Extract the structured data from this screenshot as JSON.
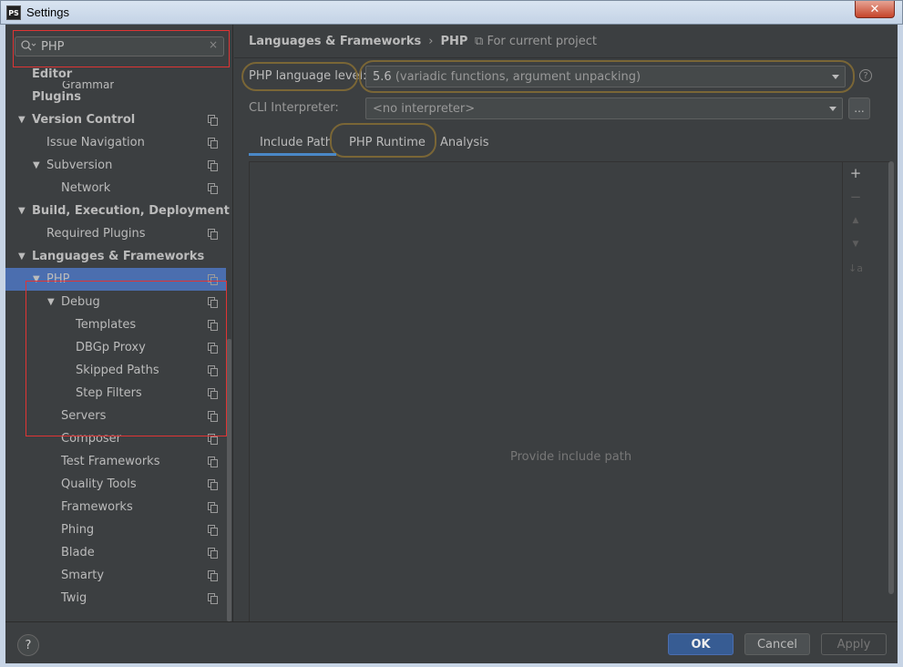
{
  "window": {
    "app_icon": "PS",
    "title": "Settings",
    "close_icon": "close-icon"
  },
  "search": {
    "value": "PHP",
    "clear_icon": "×"
  },
  "tree": {
    "partial_item": "Grammar",
    "items": [
      {
        "label": "Editor",
        "bold": true,
        "level": 0,
        "arrow": "",
        "copy": false
      },
      {
        "label": "Plugins",
        "bold": true,
        "level": 0,
        "arrow": "",
        "copy": false
      },
      {
        "label": "Version Control",
        "bold": true,
        "level": 0,
        "arrow": "▼",
        "copy": true
      },
      {
        "label": "Issue Navigation",
        "bold": false,
        "level": 1,
        "arrow": "",
        "copy": true
      },
      {
        "label": "Subversion",
        "bold": false,
        "level": 1,
        "arrow": "▼",
        "copy": true
      },
      {
        "label": "Network",
        "bold": false,
        "level": 2,
        "arrow": "",
        "copy": true
      },
      {
        "label": "Build, Execution, Deployment",
        "bold": true,
        "level": 0,
        "arrow": "▼",
        "copy": false
      },
      {
        "label": "Required Plugins",
        "bold": false,
        "level": 1,
        "arrow": "",
        "copy": true
      },
      {
        "label": "Languages & Frameworks",
        "bold": true,
        "level": 0,
        "arrow": "▼",
        "copy": false
      },
      {
        "label": "PHP",
        "bold": false,
        "level": 1,
        "arrow": "▼",
        "copy": true,
        "selected": true
      },
      {
        "label": "Debug",
        "bold": false,
        "level": 2,
        "arrow": "▼",
        "copy": true
      },
      {
        "label": "Templates",
        "bold": false,
        "level": 3,
        "arrow": "",
        "copy": true
      },
      {
        "label": "DBGp Proxy",
        "bold": false,
        "level": 3,
        "arrow": "",
        "copy": true
      },
      {
        "label": "Skipped Paths",
        "bold": false,
        "level": 3,
        "arrow": "",
        "copy": true
      },
      {
        "label": "Step Filters",
        "bold": false,
        "level": 3,
        "arrow": "",
        "copy": true
      },
      {
        "label": "Servers",
        "bold": false,
        "level": 2,
        "arrow": "",
        "copy": true
      },
      {
        "label": "Composer",
        "bold": false,
        "level": 2,
        "arrow": "",
        "copy": true
      },
      {
        "label": "Test Frameworks",
        "bold": false,
        "level": 2,
        "arrow": "",
        "copy": true
      },
      {
        "label": "Quality Tools",
        "bold": false,
        "level": 2,
        "arrow": "",
        "copy": true
      },
      {
        "label": "Frameworks",
        "bold": false,
        "level": 2,
        "arrow": "",
        "copy": true
      },
      {
        "label": "Phing",
        "bold": false,
        "level": 2,
        "arrow": "",
        "copy": true
      },
      {
        "label": "Blade",
        "bold": false,
        "level": 2,
        "arrow": "",
        "copy": true
      },
      {
        "label": "Smarty",
        "bold": false,
        "level": 2,
        "arrow": "",
        "copy": true
      },
      {
        "label": "Twig",
        "bold": false,
        "level": 2,
        "arrow": "",
        "copy": true
      }
    ]
  },
  "breadcrumb": {
    "parent": "Languages & Frameworks",
    "separator": "›",
    "current": "PHP",
    "scope": "For current project"
  },
  "php_settings": {
    "language_level_label": "PHP language level:",
    "language_level_version": "5.6",
    "language_level_desc": "(variadic functions, argument unpacking)",
    "cli_label": "CLI Interpreter:",
    "cli_value": "<no interpreter>",
    "dots_label": "...",
    "help": "?"
  },
  "tabs": [
    "Include Path",
    "PHP Runtime",
    "Analysis"
  ],
  "include_path": {
    "empty_text": "Provide include path",
    "tools": {
      "add": "+",
      "remove": "−",
      "up": "▲",
      "down": "▼",
      "sort": "↓a"
    }
  },
  "buttons": {
    "help": "?",
    "ok": "OK",
    "cancel": "Cancel",
    "apply": "Apply"
  }
}
